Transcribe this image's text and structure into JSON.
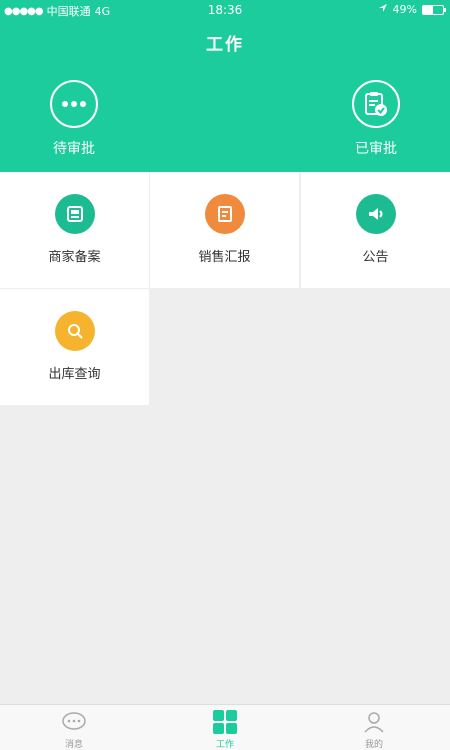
{
  "status_bar": {
    "carrier": "中国联通",
    "network": "4G",
    "time": "18:36",
    "battery": "49%"
  },
  "header": {
    "title": "工作"
  },
  "header_actions": [
    {
      "label": "待审批",
      "icon": "more-dots-icon"
    },
    {
      "label": "已审批",
      "icon": "approved-clipboard-icon"
    }
  ],
  "grid": [
    {
      "label": "商家备案",
      "icon": "record-icon",
      "color": "#1dbb92"
    },
    {
      "label": "销售汇报",
      "icon": "report-icon",
      "color": "#f08a3c"
    },
    {
      "label": "公告",
      "icon": "speaker-icon",
      "color": "#1dbb92"
    },
    {
      "label": "出库查询",
      "icon": "search-icon",
      "color": "#f5b32e"
    }
  ],
  "tabbar": [
    {
      "label": "消息",
      "icon": "message-icon"
    },
    {
      "label": "工作",
      "icon": "work-grid-icon",
      "active": true
    },
    {
      "label": "我的",
      "icon": "profile-icon"
    }
  ],
  "colors": {
    "brand": "#1dcc9c",
    "page_bg": "#eeeeee"
  }
}
